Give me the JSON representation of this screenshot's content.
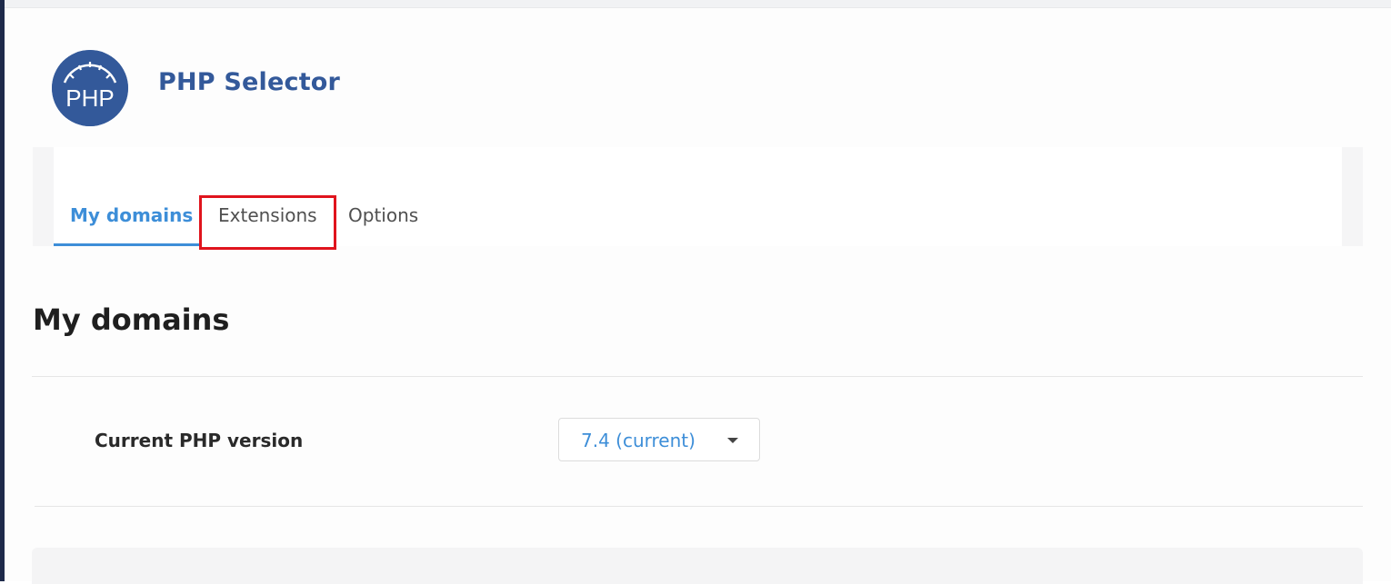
{
  "app": {
    "title": "PHP Selector",
    "logo_text": "PHP",
    "logo_icon": "php-speedometer-logo",
    "brand_color": "#33599a"
  },
  "tabs": [
    {
      "label": "My domains",
      "active": true
    },
    {
      "label": "Extensions",
      "active": false,
      "highlighted": true
    },
    {
      "label": "Options",
      "active": false
    }
  ],
  "main": {
    "heading": "My domains",
    "php_version_label": "Current PHP version",
    "php_version_value": "7.4 (current)",
    "dropdown_icon": "caret-down-icon"
  },
  "colors": {
    "accent": "#3d8ed8",
    "highlight": "#e0141d",
    "sidebar": "#1e2a4a"
  }
}
